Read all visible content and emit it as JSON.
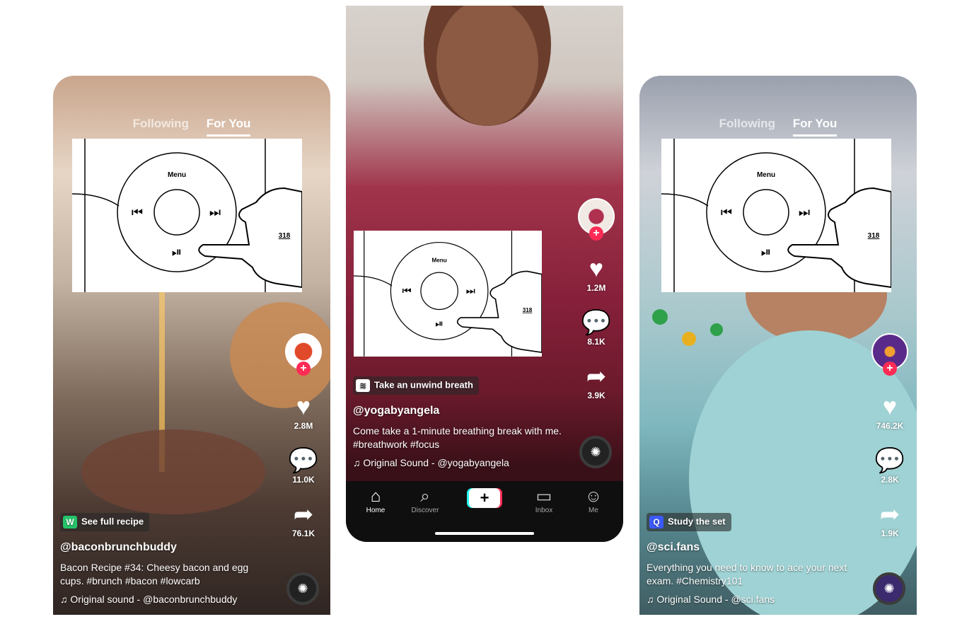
{
  "nav": {
    "following": "Following",
    "for_you": "For You"
  },
  "patent": {
    "menu": "Menu",
    "ref": "318"
  },
  "left": {
    "chip_label": "See full recipe",
    "username": "@baconbrunchbuddy",
    "description": "Bacon Recipe #34: Cheesy bacon and egg cups. #brunch #bacon #lowcarb",
    "sound": "Original sound - @baconbrunchbuddy",
    "likes": "2.8M",
    "comments": "11.0K",
    "shares": "76.1K"
  },
  "middle": {
    "chip_label": "Take an unwind breath",
    "username": "@yogabyangela",
    "description": "Come take a 1-minute breathing break with me. #breathwork #focus",
    "sound": "Original Sound - @yogabyangela",
    "likes": "1.2M",
    "comments": "8.1K",
    "shares": "3.9K",
    "tabs": {
      "home": "Home",
      "discover": "Discover",
      "inbox": "Inbox",
      "me": "Me"
    }
  },
  "right": {
    "chip_label": "Study the set",
    "username": "@sci.fans",
    "description": "Everything you need to know to ace your next exam. #Chemistry101",
    "sound": "Original Sound - @sci.fans",
    "likes": "746.2K",
    "comments": "2.8K",
    "shares": "1.9K"
  },
  "icons": {
    "heart": "heart-icon",
    "comment": "comment-icon",
    "share": "share-icon",
    "music_note": "music-note-icon",
    "plus": "plus-icon",
    "home": "home-icon",
    "discover": "search-icon",
    "inbox": "inbox-icon",
    "me": "person-icon"
  },
  "colors": {
    "accent_red": "#fe2c55",
    "accent_cyan": "#25f4ee",
    "recipe_chip": "#25c46a",
    "study_chip": "#3d5afe"
  }
}
